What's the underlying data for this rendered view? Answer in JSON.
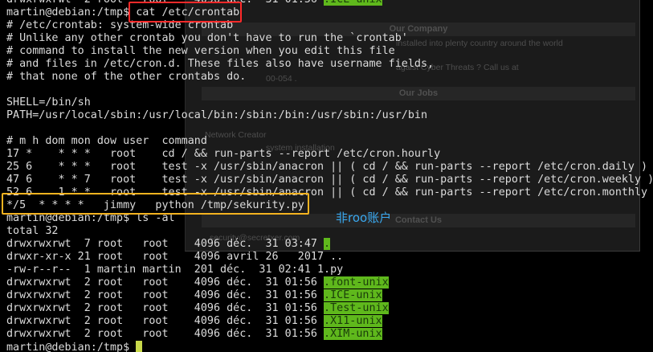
{
  "annotation": "非roo账户",
  "background_page": {
    "sections": [
      "Our Company",
      "Our Jobs",
      "Contact Us"
    ],
    "lines": [
      "installed into plenty country around the world",
      "agaist Cyber Threats ? Call us at",
      "00-054 .",
      "Network Creator",
      "system installation",
      "security@secretxer.com"
    ]
  },
  "terminal": {
    "lines": [
      {
        "text": "drwxrwxrwt  2 root   root    4096 déc.  31 01:56 ",
        "hl": ".ICE-unix"
      },
      {
        "text": "martin@debian:/tmp$ cat /etc/crontab"
      },
      {
        "text": "# /etc/crontab: system-wide crontab"
      },
      {
        "text": "# Unlike any other crontab you don't have to run the `crontab'"
      },
      {
        "text": "# command to install the new version when you edit this file"
      },
      {
        "text": "# and files in /etc/cron.d. These files also have username fields,"
      },
      {
        "text": "# that none of the other crontabs do."
      },
      {
        "text": ""
      },
      {
        "text": "SHELL=/bin/sh"
      },
      {
        "text": "PATH=/usr/local/sbin:/usr/local/bin:/sbin:/bin:/usr/sbin:/usr/bin"
      },
      {
        "text": ""
      },
      {
        "text": "# m h dom mon dow user  command"
      },
      {
        "text": "17 *    * * *   root    cd / && run-parts --report /etc/cron.hourly"
      },
      {
        "text": "25 6    * * *   root    test -x /usr/sbin/anacron || ( cd / && run-parts --report /etc/cron.daily )"
      },
      {
        "text": "47 6    * * 7   root    test -x /usr/sbin/anacron || ( cd / && run-parts --report /etc/cron.weekly )"
      },
      {
        "text": "52 6    1 * *   root    test -x /usr/sbin/anacron || ( cd / && run-parts --report /etc/cron.monthly )"
      },
      {
        "text": "*/5  * * * *   jimmy   python /tmp/sekurity.py"
      },
      {
        "text": "martin@debian:/tmp$ ls -al"
      },
      {
        "text": "total 32"
      },
      {
        "text": "drwxrwxrwt  7 root   root    4096 déc.  31 03:47 ",
        "hl": "."
      },
      {
        "text": "drwxr-xr-x 21 root   root    4096 avril 26   2017 .."
      },
      {
        "text": "-rw-r--r--  1 martin martin  201 déc.  31 02:41 1.py"
      },
      {
        "text": "drwxrwxrwt  2 root   root    4096 déc.  31 01:56 ",
        "hl": ".font-unix"
      },
      {
        "text": "drwxrwxrwt  2 root   root    4096 déc.  31 01:56 ",
        "hl": ".ICE-unix"
      },
      {
        "text": "drwxrwxrwt  2 root   root    4096 déc.  31 01:56 ",
        "hl": ".Test-unix"
      },
      {
        "text": "drwxrwxrwt  2 root   root    4096 déc.  31 01:56 ",
        "hl": ".X11-unix"
      },
      {
        "text": "drwxrwxrwt  2 root   root    4096 déc.  31 01:56 ",
        "hl": ".XIM-unix"
      },
      {
        "text": "martin@debian:/tmp$ ",
        "cursor": true
      }
    ]
  },
  "colors": {
    "highlight_green": "#5fb81c",
    "box_red": "#ff2a2a",
    "box_yellow": "#f4b320",
    "annotation_blue": "#3aa9f0"
  }
}
